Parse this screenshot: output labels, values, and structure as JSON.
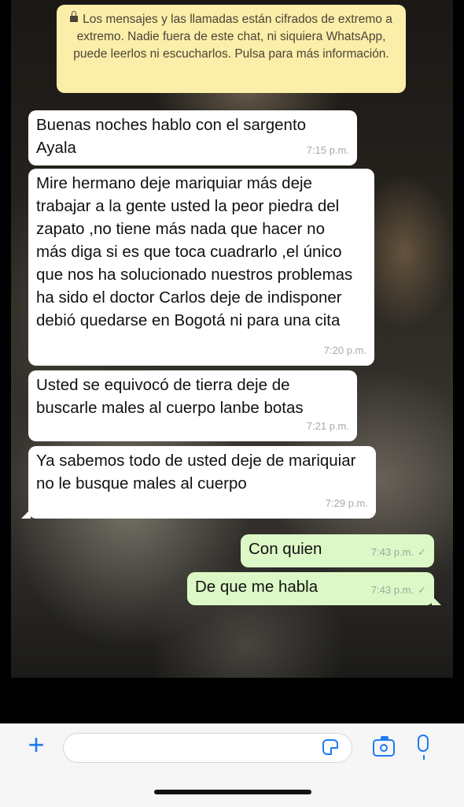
{
  "encryption_notice": {
    "text": "Los mensajes y las llamadas están cifrados de extremo a extremo. Nadie fuera de este chat, ni siquiera WhatsApp, puede leerlos ni escucharlos. Pulsa para más información.",
    "icon": "lock-icon"
  },
  "messages": [
    {
      "direction": "in",
      "text": "Buenas noches hablo con el sargento Ayala",
      "time": "7:15 p.m."
    },
    {
      "direction": "in",
      "text": "Mire hermano deje mariquiar más deje trabajar a la gente usted la peor piedra del zapato ,no tiene más nada que hacer no más diga si es que toca cuadrarlo ,el único que nos ha solucionado nuestros problemas ha sido el doctor Carlos deje de indisponer debió quedarse en Bogotá ni para una cita",
      "time": "7:20 p.m."
    },
    {
      "direction": "in",
      "text": "Usted se equivocó de tierra deje de buscarle males al cuerpo lanbe botas",
      "time": "7:21 p.m."
    },
    {
      "direction": "in",
      "text": "Ya sabemos todo de usted deje de mariquiar no le busque males al cuerpo",
      "time": "7:29 p.m."
    },
    {
      "direction": "out",
      "text": "Con quien",
      "time": "7:43 p.m.",
      "tick": "✓"
    },
    {
      "direction": "out",
      "text": "De que me habla",
      "time": "7:43 p.m.",
      "tick": "✓"
    }
  ],
  "input_bar": {
    "placeholder": "",
    "icons": [
      "plus-icon",
      "sticker-icon",
      "camera-icon",
      "microphone-icon"
    ],
    "accent_color": "#1f7bf2"
  }
}
